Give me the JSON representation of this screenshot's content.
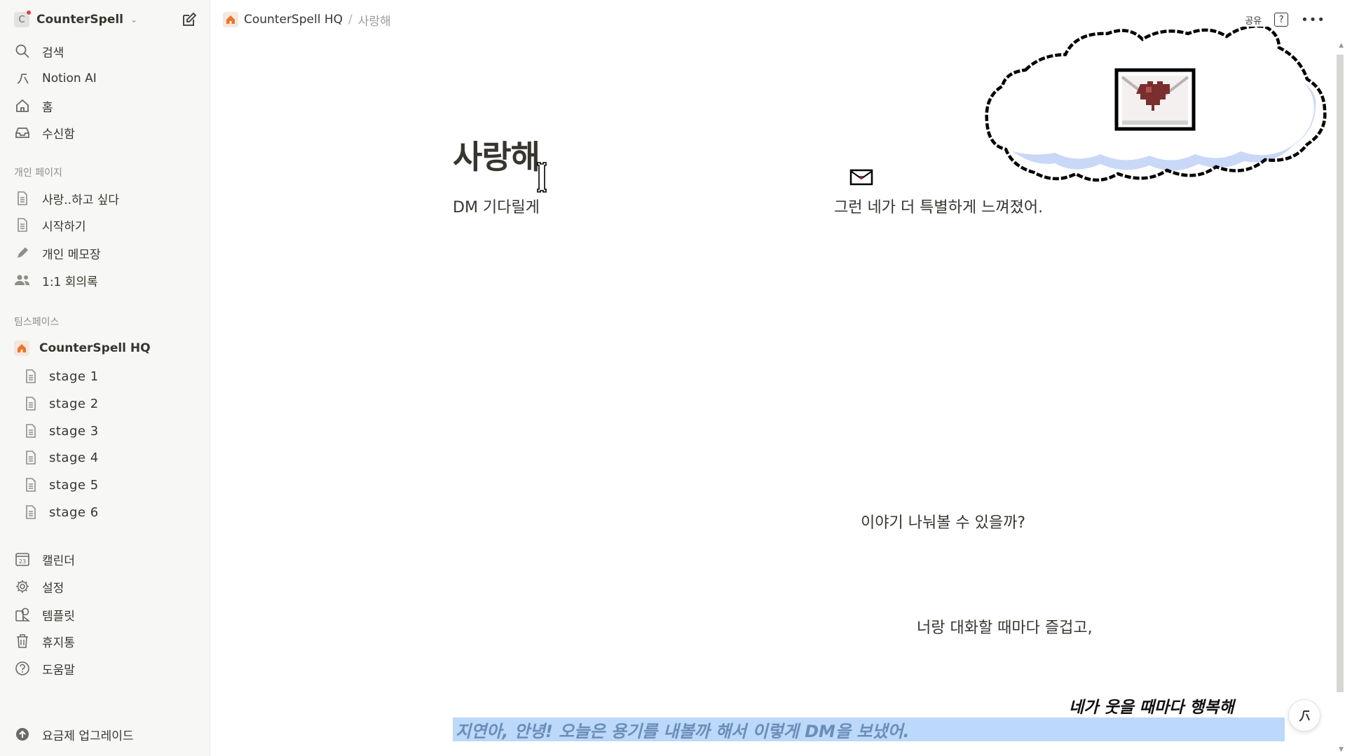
{
  "workspace": {
    "initial": "C",
    "name": "CounterSpell"
  },
  "sidebar": {
    "top_items": [
      {
        "label": "검색",
        "icon": "search-icon"
      },
      {
        "label": "Notion AI",
        "icon": "notion-ai-icon"
      },
      {
        "label": "홈",
        "icon": "home-icon"
      },
      {
        "label": "수신함",
        "icon": "inbox-icon"
      }
    ],
    "private_section": "개인 페이지",
    "private_pages": [
      {
        "label": "사랑..하고 싶다",
        "icon": "page-icon"
      },
      {
        "label": "시작하기",
        "icon": "page-icon"
      },
      {
        "label": "개인 메모장",
        "icon": "pencil-icon"
      },
      {
        "label": "1:1 회의록",
        "icon": "people-icon"
      }
    ],
    "team_section": "팀스페이스",
    "teamspace": {
      "label": "CounterSpell HQ",
      "icon": "home-icon"
    },
    "stages": [
      {
        "label": "stage 1"
      },
      {
        "label": "stage 2"
      },
      {
        "label": "stage 3"
      },
      {
        "label": "stage 4"
      },
      {
        "label": "stage 5"
      },
      {
        "label": "stage 6"
      }
    ],
    "bottom_items": [
      {
        "label": "캘린더",
        "icon": "calendar-icon",
        "badge": "23"
      },
      {
        "label": "설정",
        "icon": "gear-icon"
      },
      {
        "label": "템플릿",
        "icon": "template-icon"
      },
      {
        "label": "휴지통",
        "icon": "trash-icon"
      },
      {
        "label": "도움말",
        "icon": "help-icon"
      }
    ],
    "upgrade": "요금제 업그레이드"
  },
  "breadcrumb": {
    "workspace": "CounterSpell HQ",
    "separator": "/",
    "page": "사랑해"
  },
  "top_actions": {
    "share": "공유",
    "help": "?",
    "more": "•••"
  },
  "page": {
    "title": "사랑해",
    "line_dm": "DM 기다릴게",
    "line_special": "그런 네가 더 특별하게 느껴졌어.",
    "line_talk": "이야기 나눠볼 수 있을까?",
    "line_fun": "너랑 대화할 때마다 즐겁고,",
    "line_happy": "네가 웃을 때마다 행복해",
    "line_highlight": "지연아, 안녕!  오늘은 용기를 내볼까 해서 이렇게 DM을 보냈어."
  },
  "colors": {
    "sidebar_bg": "#f7f7f5",
    "highlight_bg": "#bcd8fa",
    "highlight_text": "#6b8eb8",
    "cloud_shadow": "#c9d8f7",
    "accent_home": "#e8762b"
  }
}
